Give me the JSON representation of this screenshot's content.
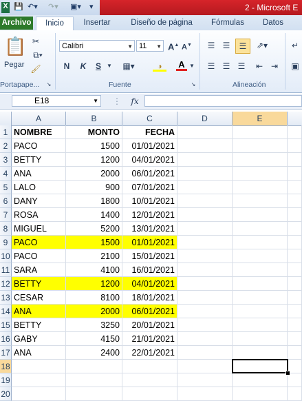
{
  "window": {
    "title": "2 - Microsoft E"
  },
  "tabs": [
    "Archivo",
    "Inicio",
    "Insertar",
    "Diseño de página",
    "Fórmulas",
    "Datos"
  ],
  "ribbon": {
    "paste_label": "Pegar",
    "clipboard_group": "Portapape...",
    "font_group": "Fuente",
    "align_group": "Alineación",
    "font_name": "Calibri",
    "font_size": "11",
    "bold": "N",
    "italic": "K",
    "underline": "S",
    "grow_font": "A",
    "shrink_font": "A"
  },
  "formula_bar": {
    "name_box": "E18",
    "fx": "fx",
    "value": ""
  },
  "columns": [
    "A",
    "B",
    "C",
    "D",
    "E"
  ],
  "rows": [
    {
      "n": "1",
      "a": "NOMBRE",
      "b": "MONTO",
      "c": "FECHA",
      "header": true
    },
    {
      "n": "2",
      "a": "PACO",
      "b": "1500",
      "c": "01/01/2021"
    },
    {
      "n": "3",
      "a": "BETTY",
      "b": "1200",
      "c": "04/01/2021"
    },
    {
      "n": "4",
      "a": "ANA",
      "b": "2000",
      "c": "06/01/2021"
    },
    {
      "n": "5",
      "a": "LALO",
      "b": "900",
      "c": "07/01/2021"
    },
    {
      "n": "6",
      "a": "DANY",
      "b": "1800",
      "c": "10/01/2021"
    },
    {
      "n": "7",
      "a": "ROSA",
      "b": "1400",
      "c": "12/01/2021"
    },
    {
      "n": "8",
      "a": "MIGUEL",
      "b": "5200",
      "c": "13/01/2021"
    },
    {
      "n": "9",
      "a": "PACO",
      "b": "1500",
      "c": "01/01/2021",
      "highlight": true
    },
    {
      "n": "10",
      "a": "PACO",
      "b": "2100",
      "c": "15/01/2021"
    },
    {
      "n": "11",
      "a": "SARA",
      "b": "4100",
      "c": "16/01/2021"
    },
    {
      "n": "12",
      "a": "BETTY",
      "b": "1200",
      "c": "04/01/2021",
      "highlight": true
    },
    {
      "n": "13",
      "a": "CESAR",
      "b": "8100",
      "c": "18/01/2021"
    },
    {
      "n": "14",
      "a": "ANA",
      "b": "2000",
      "c": "06/01/2021",
      "highlight": true
    },
    {
      "n": "15",
      "a": "BETTY",
      "b": "3250",
      "c": "20/01/2021"
    },
    {
      "n": "16",
      "a": "GABY",
      "b": "4150",
      "c": "21/01/2021"
    },
    {
      "n": "17",
      "a": "ANA",
      "b": "2400",
      "c": "22/01/2021"
    },
    {
      "n": "18",
      "a": "",
      "b": "",
      "c": "",
      "selected": true
    },
    {
      "n": "19",
      "a": "",
      "b": "",
      "c": ""
    },
    {
      "n": "20",
      "a": "",
      "b": "",
      "c": ""
    }
  ],
  "colors": {
    "highlight": "#ffff00",
    "archivo_tab": "#2d7a2a",
    "title_red": "#c8202a"
  }
}
